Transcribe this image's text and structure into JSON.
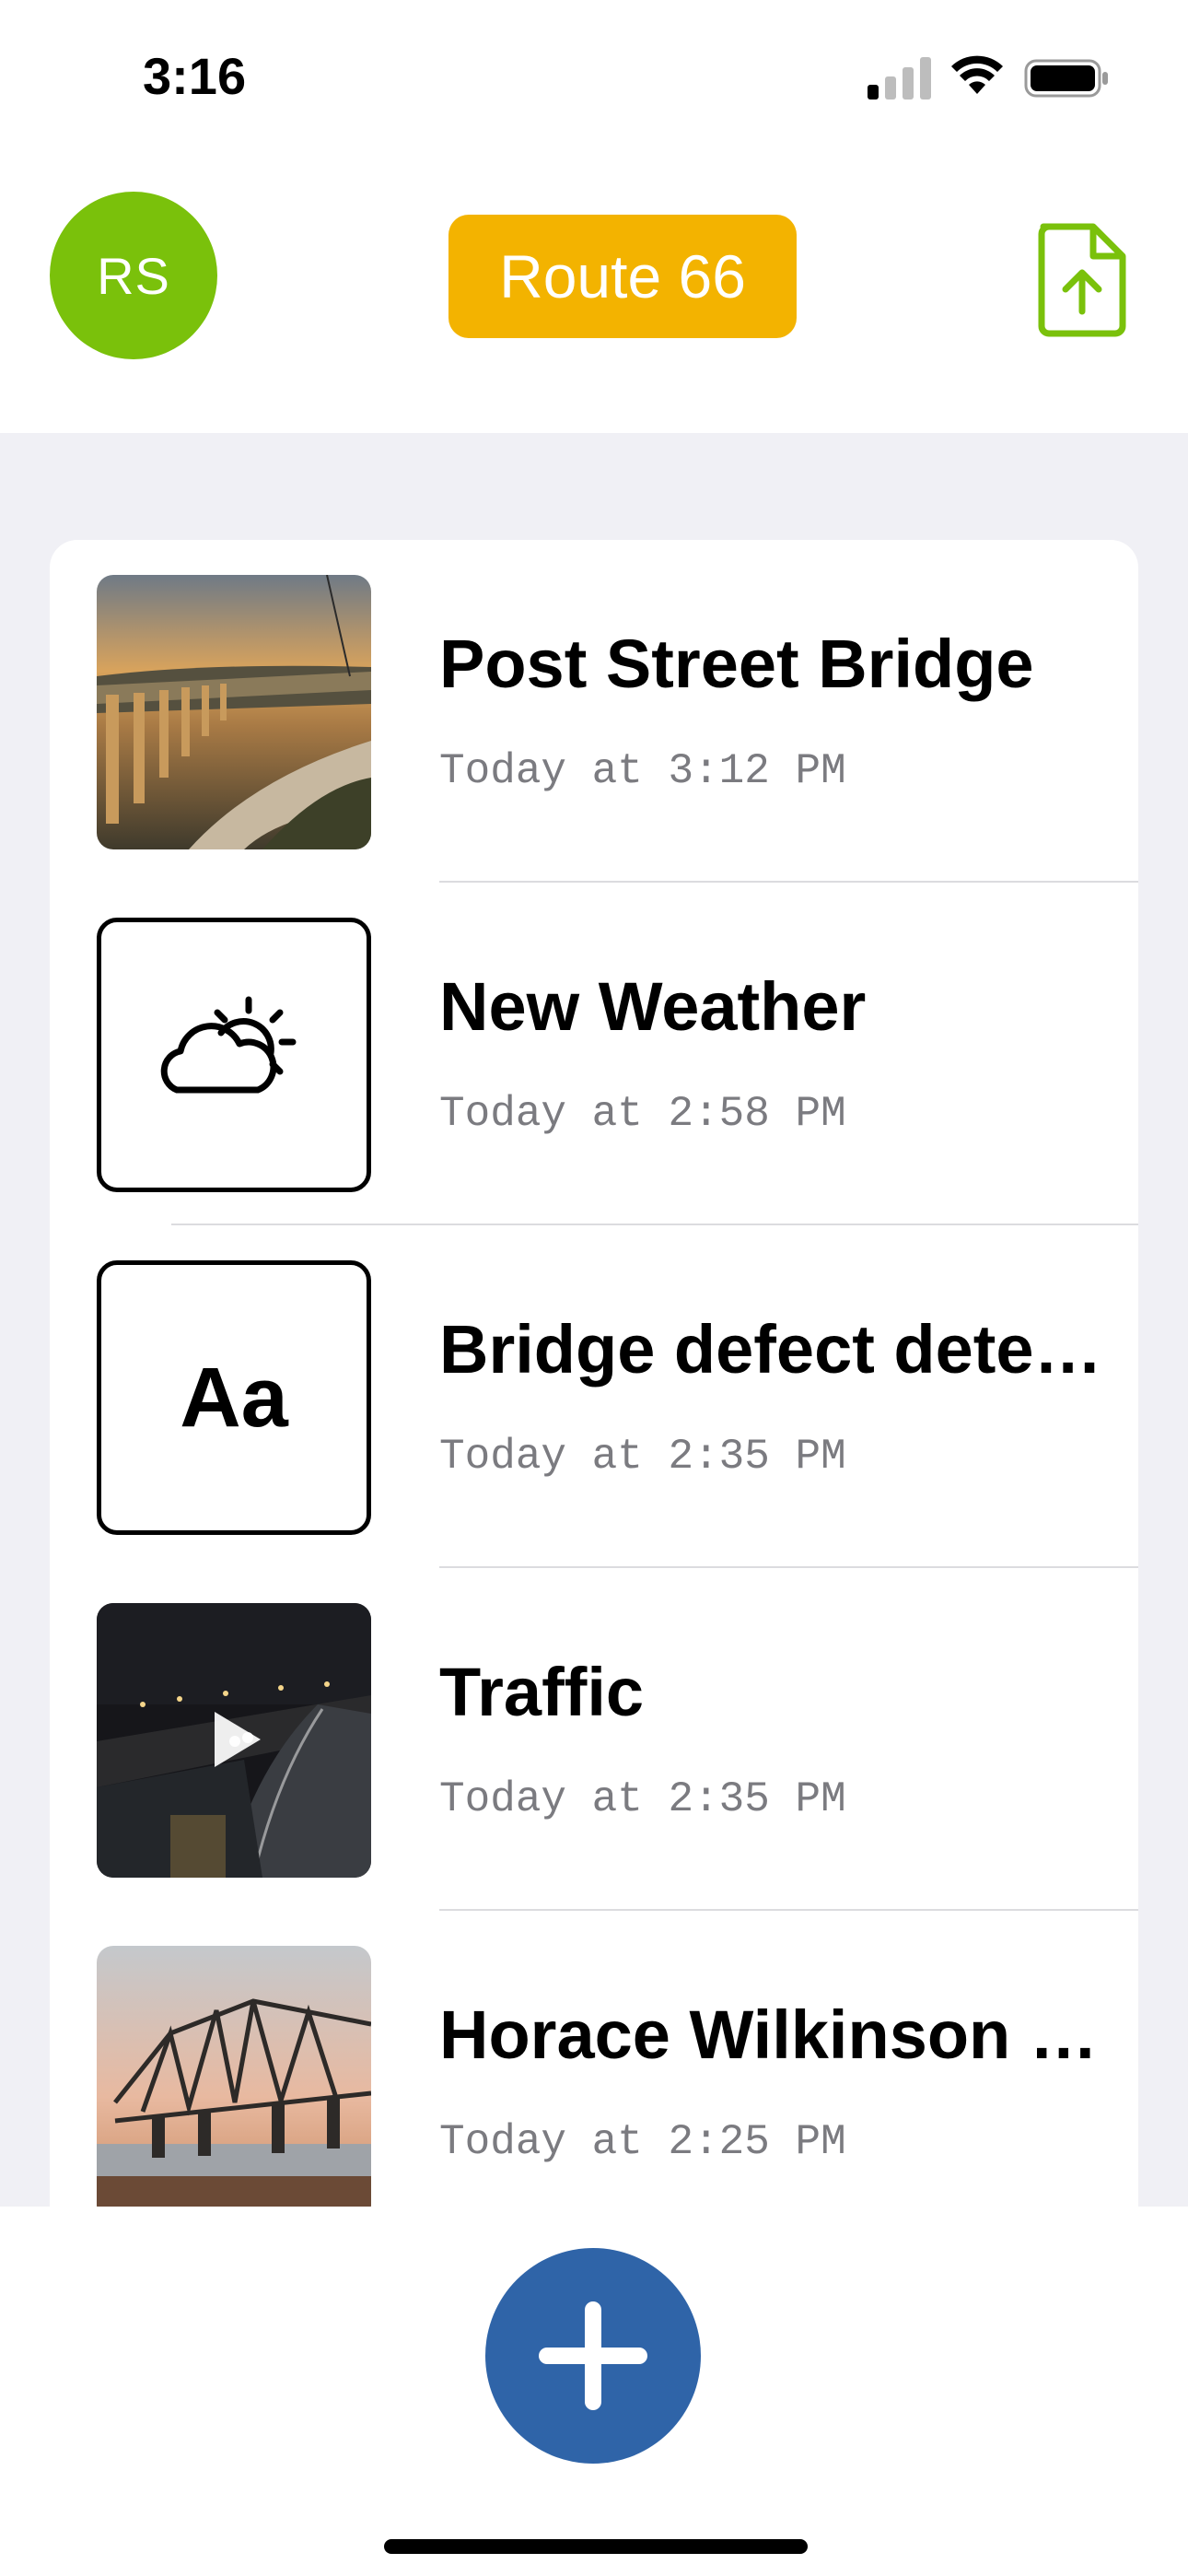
{
  "status_bar": {
    "time": "3:16",
    "signal_icon": "cellular-signal-icon",
    "wifi_icon": "wifi-icon",
    "battery_icon": "battery-icon"
  },
  "header": {
    "avatar_initials": "RS",
    "avatar_color": "#7ac10b",
    "route_label": "Route 66",
    "route_color": "#f3b300",
    "export_icon": "document-upload-icon",
    "export_color": "#7ac10b"
  },
  "items": [
    {
      "title": "Post Street Bridge",
      "time": "Today at 3:12 PM",
      "thumb": "photo-bridge-sunset"
    },
    {
      "title": "New Weather",
      "time": "Today at 2:58 PM",
      "thumb": "partly-cloudy-icon"
    },
    {
      "title": "Bridge defect detection",
      "time": "Today at 2:35 PM",
      "thumb": "text-note-icon",
      "thumb_text": "Aa"
    },
    {
      "title": "Traffic",
      "time": "Today at 2:35 PM",
      "thumb": "video-traffic-night"
    },
    {
      "title": "Horace Wilkinson Bridge",
      "time": "Today at 2:25 PM",
      "thumb": "photo-steel-truss-bridge"
    }
  ],
  "add_button": {
    "icon": "plus-icon",
    "color": "#2f64a8"
  }
}
